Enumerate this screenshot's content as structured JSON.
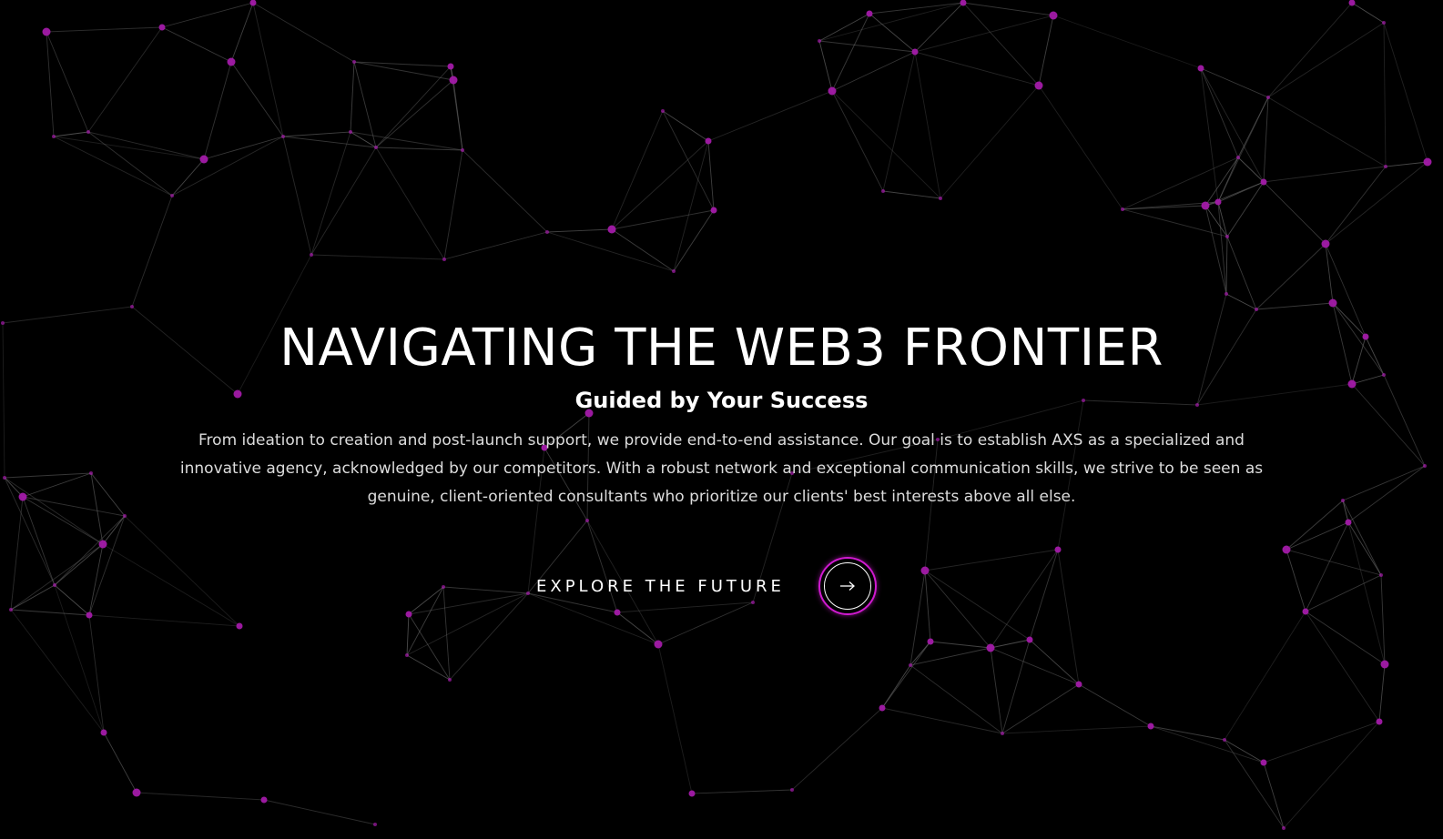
{
  "hero": {
    "title": "NAVIGATING THE WEB3 FRONTIER",
    "subtitle": "Guided by Your Success",
    "description": "From ideation to creation and post-launch support, we provide end-to-end assistance. Our goal is to establish AXS as a specialized and innovative agency, acknowledged by our competitors. With a robust network and exceptional communication skills, we strive to be seen as genuine, client-oriented consultants who prioritize our clients' best interests above all else.",
    "cta_label": "EXPLORE THE FUTURE",
    "cta_icon": "arrow-right-icon"
  },
  "theme": {
    "background": "#000000",
    "accent": "#d01ad0",
    "text": "#ffffff",
    "node_color": "#a21aa8",
    "line_color": "#6a6a6a"
  }
}
